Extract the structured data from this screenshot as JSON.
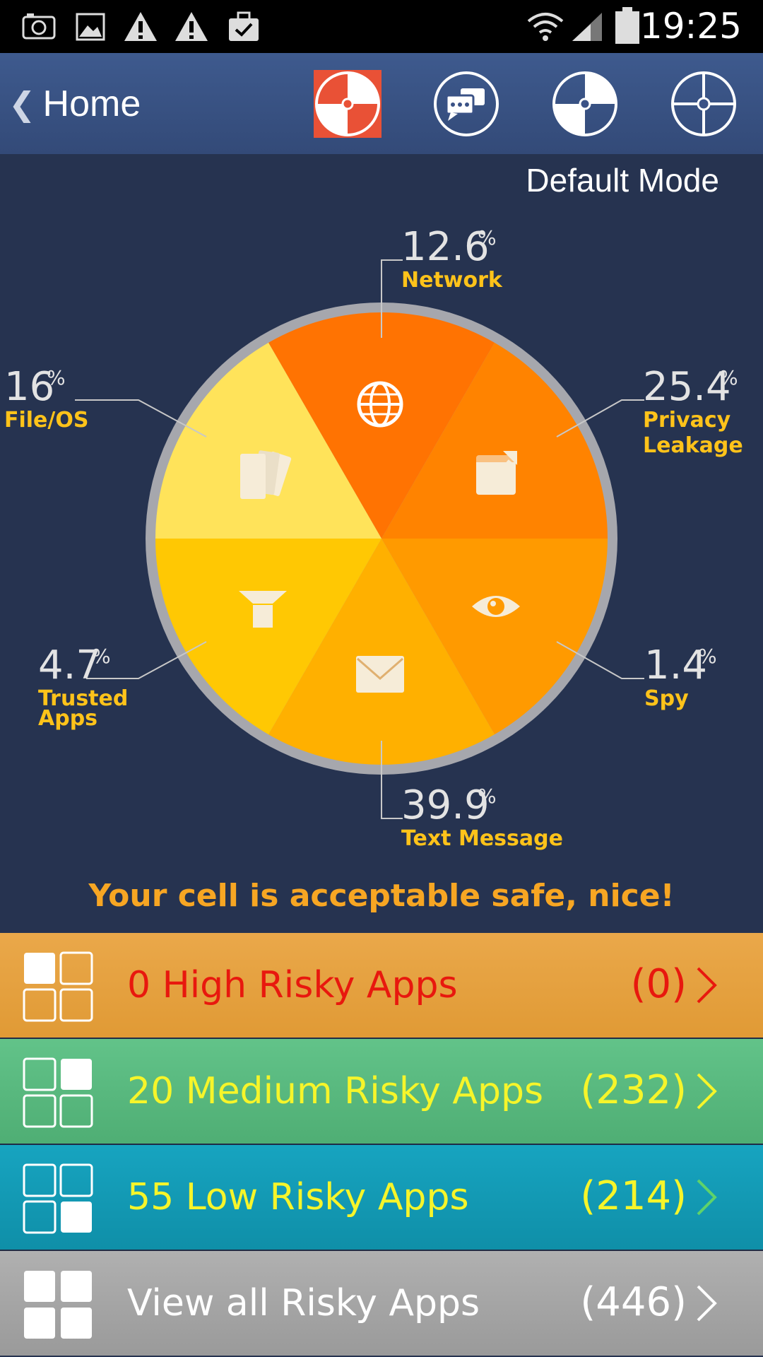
{
  "status_bar": {
    "time": "19:25",
    "icons": [
      "camera-icon",
      "gallery-icon",
      "warning-icon",
      "warning-icon",
      "task-icon",
      "wifi-icon",
      "signal-icon",
      "battery-icon"
    ]
  },
  "header": {
    "back_label": "Home",
    "tabs": [
      "overview-tab",
      "messages-tab",
      "scan-tab",
      "settings-tab"
    ]
  },
  "mode_label": "Default Mode",
  "chart_data": {
    "type": "pie",
    "slices": [
      {
        "pct": "12.6",
        "name": "Network",
        "value": 12.6,
        "color": "#ff7302",
        "icon": "globe-icon"
      },
      {
        "pct": "25.4",
        "name": "Privacy",
        "name2": "Leakage",
        "value": 25.4,
        "color": "#ff8300",
        "icon": "share-icon"
      },
      {
        "pct": "1.4",
        "name": "Spy",
        "value": 1.4,
        "color": "#ff9a00",
        "icon": "eye-icon"
      },
      {
        "pct": "39.9",
        "name": "Text Message",
        "value": 39.9,
        "color": "#ffb000",
        "icon": "mail-icon"
      },
      {
        "pct": "4.7",
        "name": "Trusted",
        "name2": "Apps",
        "value": 4.7,
        "color": "#ffc803",
        "icon": "filter-icon"
      },
      {
        "pct": "16",
        "name": "File/OS",
        "value": 16,
        "color": "#ffe35a",
        "icon": "files-icon"
      }
    ],
    "pct_sign": "%"
  },
  "safe_message": "Your cell is acceptable safe, nice!",
  "rows": {
    "high": {
      "label": "0 High Risky Apps",
      "count": "(0)",
      "text_color": "#e8180e"
    },
    "medium": {
      "label": "20 Medium Risky Apps",
      "count": "(232)",
      "text_color": "#f6f52a"
    },
    "low": {
      "label": "55 Low Risky Apps",
      "count": "(214)",
      "text_color": "#f6f52a"
    },
    "all": {
      "label": "View all Risky Apps",
      "count": "(446)",
      "text_color": "#ffffff"
    }
  }
}
